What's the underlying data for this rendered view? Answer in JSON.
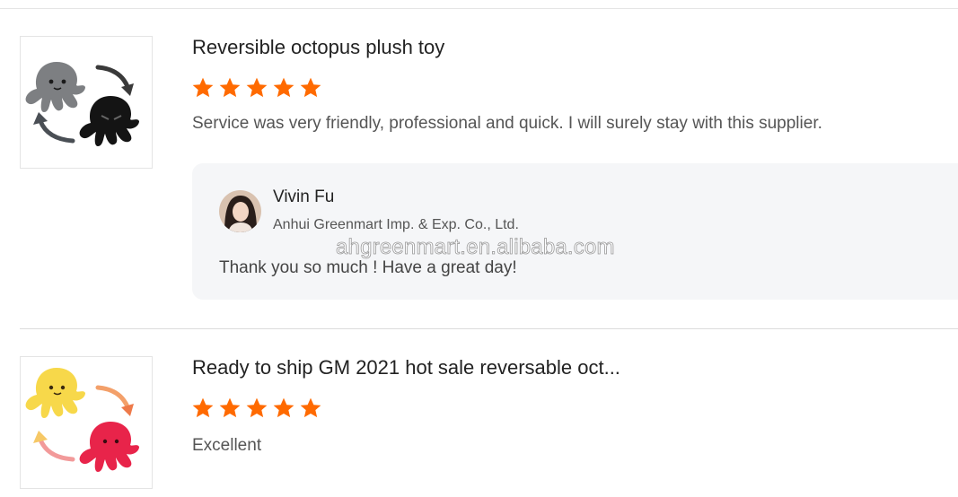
{
  "reviews": [
    {
      "product_title": "Reversible octopus plush toy",
      "rating": 5,
      "rating_max": 5,
      "text": "Service was very friendly, professional and quick. I will surely stay with this supplier.",
      "thumbnail_colors": [
        "#7d7f82",
        "#141414"
      ],
      "reply": {
        "name": "Vivin Fu",
        "company": "Anhui Greenmart Imp. & Exp. Co., Ltd.",
        "text": "Thank you so much !  Have a great day!"
      }
    },
    {
      "product_title": "Ready to ship GM 2021 hot sale reversable oct...",
      "rating": 5,
      "rating_max": 5,
      "text": "Excellent",
      "thumbnail_colors": [
        "#f7d84a",
        "#e8244a"
      ]
    }
  ],
  "watermark": "ahgreenmart.en.alibaba.com",
  "colors": {
    "star": "#ff6a00",
    "reply_background": "#f5f6f8",
    "divider": "#dcdcdc"
  },
  "icons": {
    "star": "star-icon",
    "avatar": "avatar"
  }
}
